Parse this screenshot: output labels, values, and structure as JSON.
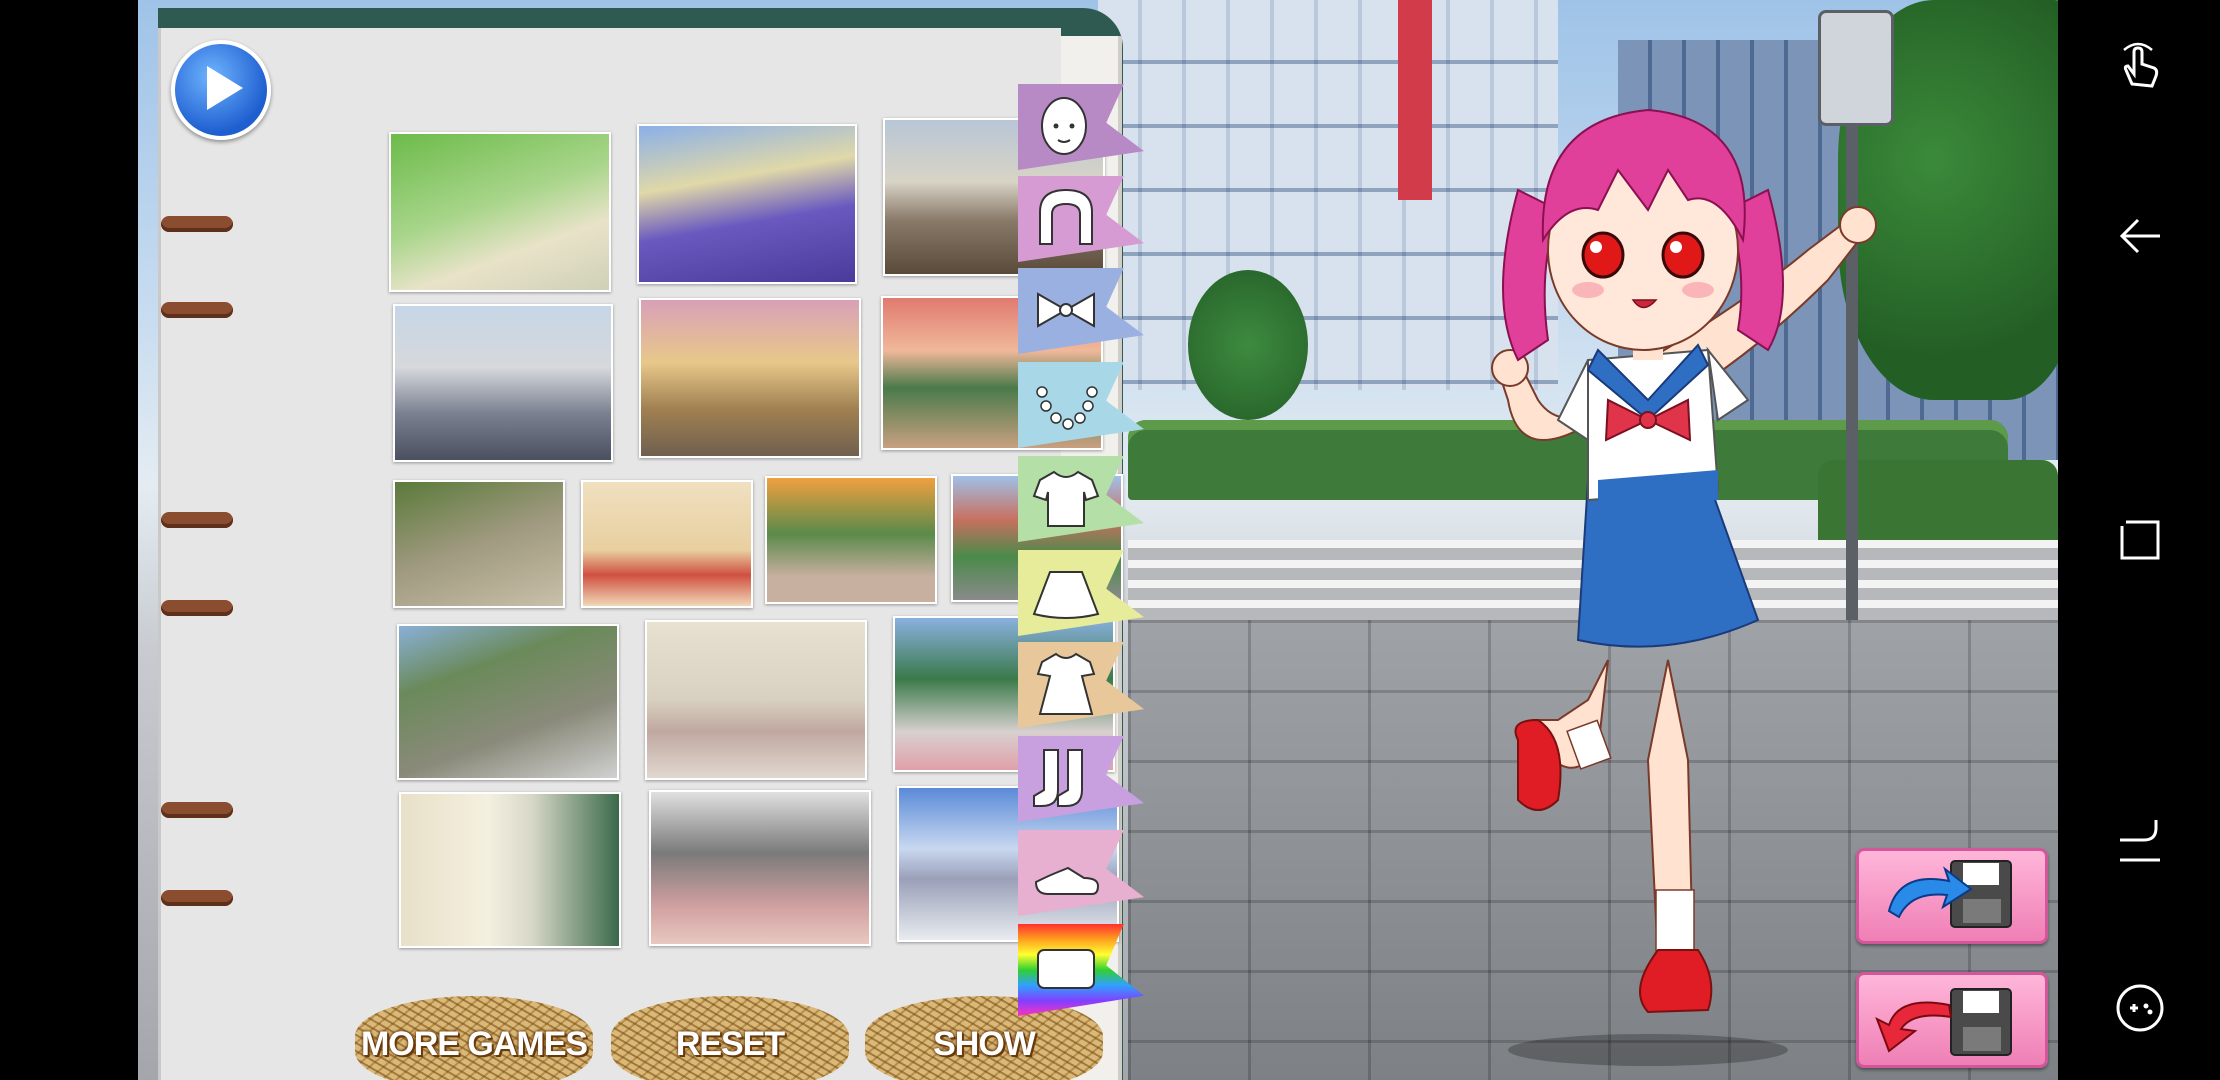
{
  "game": {
    "play_icon": "play-icon",
    "backgrounds": [
      {
        "name": "tree-lined-path"
      },
      {
        "name": "school-building-purple"
      },
      {
        "name": "railway-town"
      },
      {
        "name": "railroad-crossing"
      },
      {
        "name": "dusk-houses"
      },
      {
        "name": "sunset-promenade"
      },
      {
        "name": "stone-slope"
      },
      {
        "name": "bedroom"
      },
      {
        "name": "park-fountain"
      },
      {
        "name": "town-street"
      },
      {
        "name": "stone-wall"
      },
      {
        "name": "school-hallway"
      },
      {
        "name": "school-gate"
      },
      {
        "name": "school-corridor"
      },
      {
        "name": "station-plaza"
      },
      {
        "name": "blue-sky-school"
      }
    ],
    "buttons": {
      "more_games": "MORE GAMES",
      "reset": "RESET",
      "show": "SHOW"
    },
    "categories": [
      {
        "name": "face",
        "icon": "face-icon",
        "color": "#b78ac6"
      },
      {
        "name": "hair",
        "icon": "hair-icon",
        "color": "#d59bd2"
      },
      {
        "name": "bow",
        "icon": "bow-icon",
        "color": "#9ab0e0"
      },
      {
        "name": "necklace",
        "icon": "necklace-icon",
        "color": "#a8d8e8"
      },
      {
        "name": "top",
        "icon": "shirt-icon",
        "color": "#b4e0a8"
      },
      {
        "name": "skirt",
        "icon": "skirt-icon",
        "color": "#e6ec9a"
      },
      {
        "name": "dress",
        "icon": "dress-icon",
        "color": "#e8c89a"
      },
      {
        "name": "socks",
        "icon": "socks-icon",
        "color": "#c8a0e0"
      },
      {
        "name": "shoes",
        "icon": "shoe-icon",
        "color": "#e8b0d0"
      },
      {
        "name": "color",
        "icon": "rainbow-icon",
        "color": "#ff4040"
      }
    ],
    "save_buttons": [
      {
        "name": "save-load-button",
        "icon": "floppy-blue-arrow-icon"
      },
      {
        "name": "save-restore-button",
        "icon": "floppy-red-arrow-icon"
      }
    ]
  },
  "system_nav": [
    "touch-gesture-icon",
    "back-icon",
    "recent-apps-icon",
    "rotate-icon",
    "gamepad-icon"
  ]
}
